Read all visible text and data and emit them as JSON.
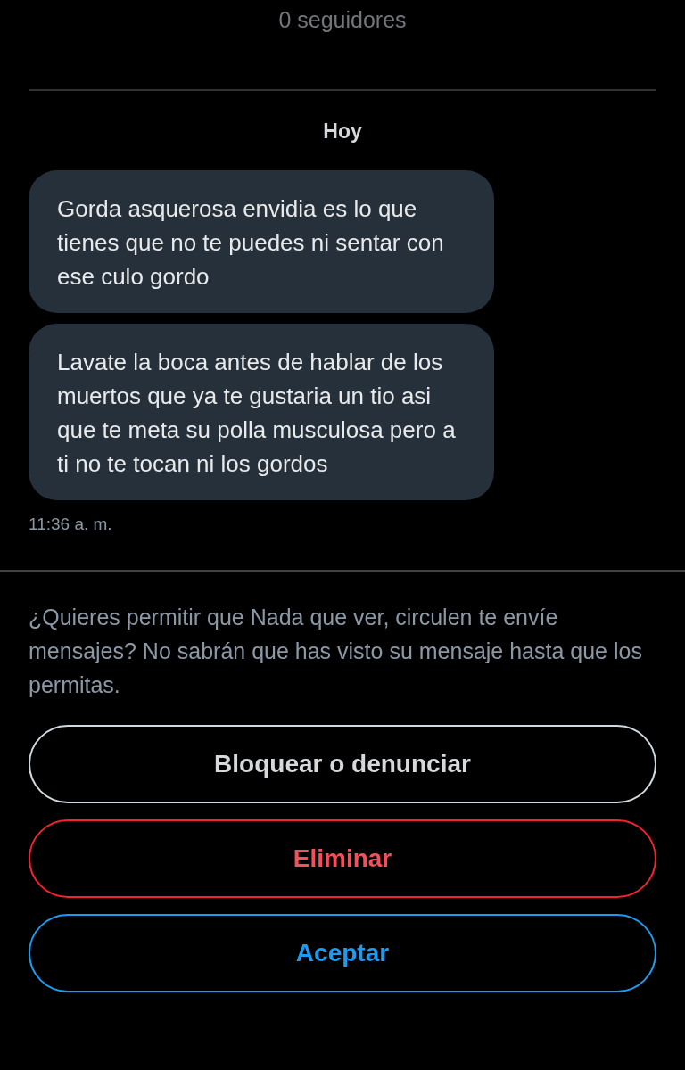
{
  "header": {
    "followers": "0 seguidores"
  },
  "day": "Hoy",
  "messages": [
    {
      "text": "Gorda asquerosa envidia es lo que tienes que no te puedes ni sentar con ese culo gordo"
    },
    {
      "text": "Lavate la boca antes de hablar de los muertos que ya te gustaria un tio asi que te meta su polla musculosa pero a ti no te tocan ni los gordos"
    }
  ],
  "time": "11:36 a. m.",
  "prompt": "¿Quieres permitir que Nada que ver, circulen te envíe mensajes? No sabrán que has visto su mensaje hasta que los permitas.",
  "buttons": [
    {
      "label": "Bloquear o denunciar",
      "kind": "neutral"
    },
    {
      "label": "Eliminar",
      "kind": "danger"
    },
    {
      "label": "Aceptar",
      "kind": "primary"
    }
  ]
}
